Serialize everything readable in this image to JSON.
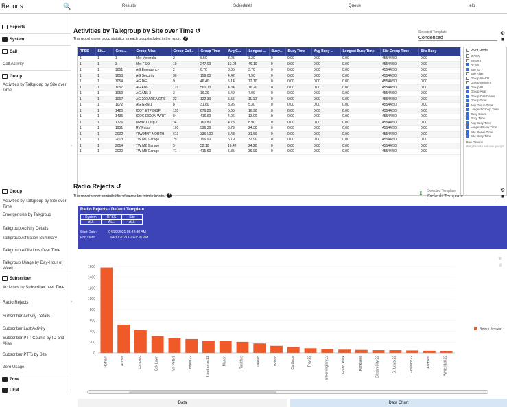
{
  "topbar": {
    "brand": "Reports",
    "tabs": [
      "Results",
      "Schedules",
      "Queue",
      "Help"
    ]
  },
  "sidebar": {
    "items": [
      {
        "type": "head",
        "label": "Reports"
      },
      {
        "type": "head",
        "label": "System"
      },
      {
        "type": "head",
        "label": "Call"
      },
      {
        "type": "item",
        "label": "Call Activity"
      },
      {
        "type": "head",
        "label": "Group"
      },
      {
        "type": "item",
        "label": "Activities by Talkgroup by Site over Time"
      }
    ],
    "items2": [
      {
        "type": "head",
        "label": "Group"
      },
      {
        "type": "item",
        "label": "Activities by Talkgroup by Site over Time"
      },
      {
        "type": "item",
        "label": "Emergencies by Talkgroup"
      },
      {
        "type": "item",
        "label": "Talkgroup Activity Details"
      },
      {
        "type": "item",
        "label": "Talkgroup Affiliation Summary"
      },
      {
        "type": "item",
        "label": "Talkgroup Affiliations Over Time"
      },
      {
        "type": "item",
        "label": "Talkgroup Usage by Day-Hour of Week"
      },
      {
        "type": "head",
        "label": "Subscriber"
      },
      {
        "type": "item",
        "label": "Activities by Subscriber over Time"
      },
      {
        "type": "item",
        "label": "Radio Rejects"
      },
      {
        "type": "item",
        "label": "Subscriber Activity Details"
      },
      {
        "type": "item",
        "label": "Subscriber Last Activity"
      },
      {
        "type": "item",
        "label": "Subscriber PTT Counts by ID and Alias"
      },
      {
        "type": "item",
        "label": "Subscriber PTTs by Site"
      },
      {
        "type": "item",
        "label": "Zero Usage"
      },
      {
        "type": "head",
        "label": "Zone"
      },
      {
        "type": "head",
        "label": "UEM"
      }
    ]
  },
  "report1": {
    "title": "Activities by Talkgroup by Site over Time",
    "subtitle": "This report shows group statistics for each group included in the report.",
    "template_label": "Selected Template",
    "template_value": "Condensed",
    "columns": [
      "RFSS",
      "Sit...",
      "Grou...",
      "Group Alias",
      "Group Call...",
      "Group Time",
      "Avg G...",
      "Longest ...",
      "Busy...",
      "Busy Time",
      "Avg Busy ...",
      "Longest Busy Time",
      "Site Group Time",
      "Site Busy"
    ],
    "rows": [
      [
        "1",
        "1",
        "1",
        "Mot Motorola",
        "2",
        "6.50",
        "3.25",
        "3.30",
        "0",
        "0.00",
        "0.00",
        "0.00",
        "45544.50",
        "0.00"
      ],
      [
        "1",
        "1",
        "3",
        "Mot FSO",
        "19",
        "247.00",
        "13.04",
        "46.10",
        "0",
        "0.00",
        "0.00",
        "0.00",
        "45544.50",
        "0.00"
      ],
      [
        "1",
        "1",
        "1051",
        "AG Emergency",
        "2",
        "6.70",
        "3.35",
        "3.70",
        "0",
        "0.00",
        "0.00",
        "0.00",
        "45544.50",
        "0.00"
      ],
      [
        "1",
        "1",
        "1053",
        "AG Security",
        "36",
        "159.00",
        "4.42",
        "7.90",
        "0",
        "0.00",
        "0.00",
        "0.00",
        "45544.50",
        "0.00"
      ],
      [
        "1",
        "1",
        "1054",
        "AG DG",
        "9",
        "46.40",
        "5.14",
        "12.10",
        "0",
        "0.00",
        "0.00",
        "0.00",
        "45544.50",
        "0.00"
      ],
      [
        "1",
        "1",
        "1057",
        "AG ANL 1",
        "129",
        "560.10",
        "4.34",
        "16.20",
        "0",
        "0.00",
        "0.00",
        "0.00",
        "45544.50",
        "0.00"
      ],
      [
        "1",
        "1",
        "1059",
        "AG ANL 3",
        "3",
        "16.20",
        "5.40",
        "7.00",
        "0",
        "0.00",
        "0.00",
        "0.00",
        "45544.50",
        "0.00"
      ],
      [
        "1",
        "1",
        "1067",
        "AG 200 AREA OPS",
        "22",
        "122.30",
        "5.56",
        "11.10",
        "0",
        "0.00",
        "0.00",
        "0.00",
        "45544.50",
        "0.00"
      ],
      [
        "1",
        "1",
        "1072",
        "AG GRN 1",
        "8",
        "31.60",
        "3.95",
        "5.30",
        "0",
        "0.00",
        "0.00",
        "0.00",
        "45544.50",
        "0.00"
      ],
      [
        "1",
        "1",
        "1420",
        "IDOT ETP DISP",
        "155",
        "876.20",
        "5.65",
        "16.90",
        "0",
        "0.00",
        "0.00",
        "0.00",
        "45544.50",
        "0.00"
      ],
      [
        "1",
        "1",
        "1435",
        "IDOC DIXON WRIT",
        "84",
        "416.60",
        "4.96",
        "13.00",
        "0",
        "0.00",
        "0.00",
        "0.00",
        "45544.50",
        "0.00"
      ],
      [
        "1",
        "1",
        "1776",
        "MWRD Disp 1",
        "34",
        "160.80",
        "4.73",
        "8.90",
        "0",
        "0.00",
        "0.00",
        "0.00",
        "45544.50",
        "0.00"
      ],
      [
        "1",
        "1",
        "1951",
        "RV Patrol",
        "103",
        "596.30",
        "5.79",
        "24.30",
        "0",
        "0.00",
        "0.00",
        "0.00",
        "45544.50",
        "0.00"
      ],
      [
        "1",
        "1",
        "2002",
        "*TW MNT-NORTH",
        "613",
        "3364.00",
        "5.48",
        "31.60",
        "0",
        "0.00",
        "0.00",
        "0.00",
        "45544.50",
        "0.00"
      ],
      [
        "1",
        "1",
        "2013",
        "TW M1 Garage",
        "29",
        "196.90",
        "6.79",
        "32.90",
        "0",
        "0.00",
        "0.00",
        "0.00",
        "45544.50",
        "0.00"
      ],
      [
        "1",
        "1",
        "2014",
        "TW M2 Garage",
        "5",
        "52.10",
        "10.42",
        "24.20",
        "0",
        "0.00",
        "0.00",
        "0.00",
        "45544.50",
        "0.00"
      ],
      [
        "1",
        "1",
        "2020",
        "TW M8 Garage",
        "71",
        "415.60",
        "5.85",
        "36.90",
        "0",
        "0.00",
        "0.00",
        "0.00",
        "45544.50",
        "0.00"
      ]
    ],
    "panel_title": "Pivot Mode",
    "panel_items": [
      {
        "label": "WACN",
        "on": false
      },
      {
        "label": "System",
        "on": false
      },
      {
        "label": "RFSS",
        "on": true
      },
      {
        "label": "Site ID",
        "on": true
      },
      {
        "label": "Site Alias",
        "on": false
      },
      {
        "label": "Group WACN",
        "on": false
      },
      {
        "label": "Group System",
        "on": false
      },
      {
        "label": "Group ID",
        "on": true
      },
      {
        "label": "Group Alias",
        "on": true
      },
      {
        "label": "Group Call Count",
        "on": true
      },
      {
        "label": "Group Time",
        "on": true
      },
      {
        "label": "Avg Group Time",
        "on": true
      },
      {
        "label": "Longest Group Time",
        "on": true
      },
      {
        "label": "Busy Count",
        "on": true
      },
      {
        "label": "Busy Time",
        "on": true
      },
      {
        "label": "Avg Busy Time",
        "on": true
      },
      {
        "label": "Longest Busy Time",
        "on": true
      },
      {
        "label": "Site Group Time",
        "on": true
      },
      {
        "label": "Site Busy Time",
        "on": true
      }
    ],
    "panel_footer": "Row Groups",
    "panel_hint": "Drag here to set row groups"
  },
  "report2": {
    "title": "Radio Rejects",
    "subtitle": "This report shows a detailed list of subscriber rejects by site.",
    "template_label": "Selected Template",
    "template_value": "Default Template",
    "banner_title": "Radio Rejects - Default Template",
    "banner_headers": [
      "System",
      "RFSS",
      "Site"
    ],
    "banner_values": [
      "ALL",
      "ALL",
      "ALL"
    ],
    "start_date": "Start Date:",
    "start_value": "04/30/2021 08:42:30 AM",
    "end_date": "End Date:",
    "end_value": "04/30/2021 02:42:30 PM",
    "tab_data": "Data",
    "tab_chart": "Data Chart",
    "colors": {
      "bar": "#f05a28",
      "banner": "#3c44b8"
    }
  },
  "chart_data": {
    "type": "bar",
    "categories": [
      "Hotham",
      "Aurora",
      "Lombard",
      "Oak Lawn",
      "St. Peters",
      "Cornell 22",
      "Hawthorne 22",
      "Marion",
      "Rockford",
      "Dekalb",
      "Wilson",
      "Carthage",
      "Troy 22",
      "Bloomington 22",
      "Grand Rock",
      "Kankakee",
      "Gibson City 22",
      "St. Louis 22",
      "Florence 22",
      "Andover",
      "White Hall 22"
    ],
    "values": [
      1580,
      520,
      420,
      310,
      270,
      255,
      225,
      225,
      205,
      175,
      130,
      110,
      85,
      70,
      60,
      55,
      50,
      50,
      45,
      40,
      35
    ],
    "series": [
      {
        "name": "Reject Reason",
        "values": [
          1580,
          520,
          420,
          310,
          270,
          255,
          225,
          225,
          205,
          175,
          130,
          110,
          85,
          70,
          60,
          55,
          50,
          50,
          45,
          40,
          35
        ]
      }
    ],
    "yticks": [
      0,
      200,
      400,
      600,
      800,
      1000,
      1200,
      1400,
      1600
    ],
    "ylim": [
      0,
      1650
    ],
    "legend": "right"
  }
}
